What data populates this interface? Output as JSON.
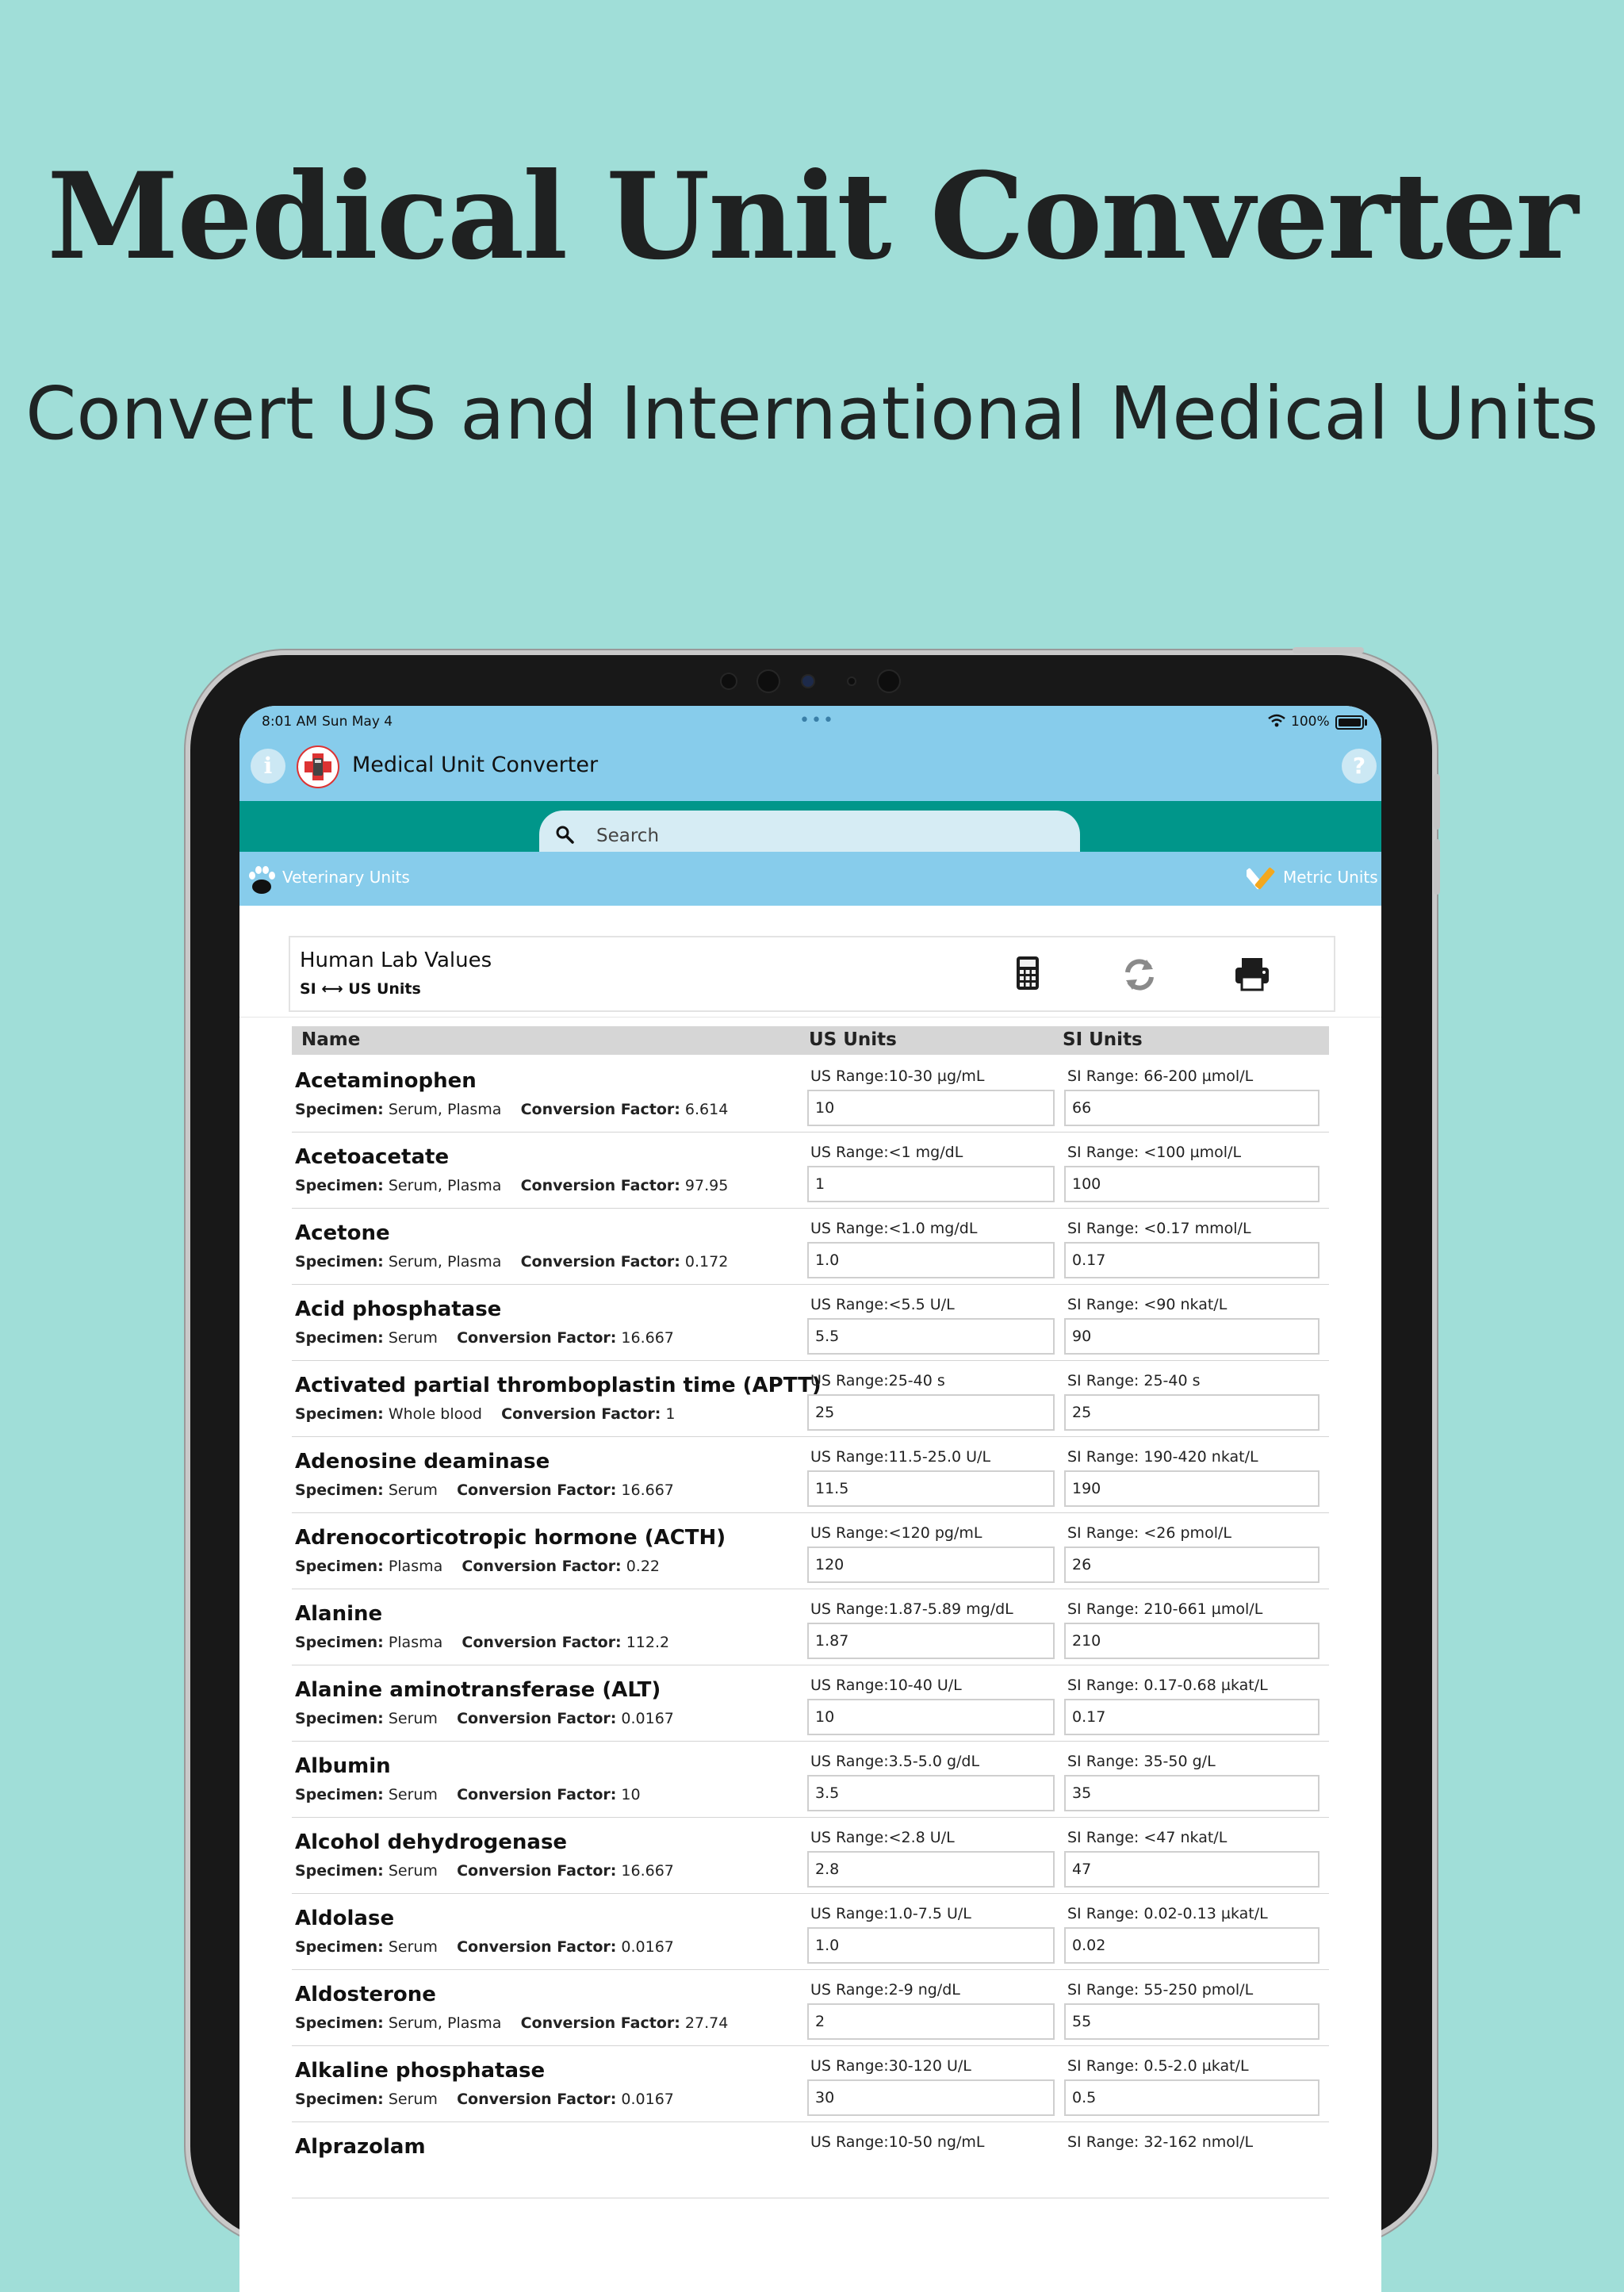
{
  "promo": {
    "title": "Medical Unit Converter",
    "subtitle": "Convert US and International Medical Units"
  },
  "status": {
    "time": "8:01 AM",
    "date": "Sun May 4",
    "battery": "100%"
  },
  "header": {
    "title": "Medical Unit Converter",
    "info_icon": "i",
    "help_icon": "?"
  },
  "search": {
    "placeholder": "Search"
  },
  "units_bar": {
    "left": "Veterinary Units",
    "right": "Metric Units"
  },
  "card": {
    "title": "Human Lab Values",
    "subtitle": "SI ⟷ US Units"
  },
  "table": {
    "headers": {
      "name": "Name",
      "us": "US Units",
      "si": "SI Units"
    },
    "specimen_label": "Specimen:",
    "factor_label": "Conversion Factor:",
    "rows": [
      {
        "name": "Acetaminophen",
        "specimen": "Serum, Plasma",
        "factor": "6.614",
        "us_range": "US Range:10-30 µg/mL",
        "si_range": "SI Range: 66-200 µmol/L",
        "us_value": "10",
        "si_value": "66"
      },
      {
        "name": "Acetoacetate",
        "specimen": "Serum, Plasma",
        "factor": "97.95",
        "us_range": "US Range:<1 mg/dL",
        "si_range": "SI Range: <100 µmol/L",
        "us_value": "1",
        "si_value": "100"
      },
      {
        "name": "Acetone",
        "specimen": "Serum, Plasma",
        "factor": "0.172",
        "us_range": "US Range:<1.0 mg/dL",
        "si_range": "SI Range: <0.17 mmol/L",
        "us_value": "1.0",
        "si_value": "0.17"
      },
      {
        "name": "Acid phosphatase",
        "specimen": "Serum",
        "factor": "16.667",
        "us_range": "US Range:<5.5 U/L",
        "si_range": "SI Range: <90 nkat/L",
        "us_value": "5.5",
        "si_value": "90"
      },
      {
        "name": "Activated partial thromboplastin time (APTT)",
        "specimen": "Whole blood",
        "factor": "1",
        "us_range": "US Range:25-40 s",
        "si_range": "SI Range: 25-40 s",
        "us_value": "25",
        "si_value": "25"
      },
      {
        "name": "Adenosine deaminase",
        "specimen": "Serum",
        "factor": "16.667",
        "us_range": "US Range:11.5-25.0 U/L",
        "si_range": "SI Range: 190-420 nkat/L",
        "us_value": "11.5",
        "si_value": "190"
      },
      {
        "name": "Adrenocorticotropic hormone (ACTH)",
        "specimen": "Plasma",
        "factor": "0.22",
        "us_range": "US Range:<120 pg/mL",
        "si_range": "SI Range: <26 pmol/L",
        "us_value": "120",
        "si_value": "26"
      },
      {
        "name": "Alanine",
        "specimen": "Plasma",
        "factor": "112.2",
        "us_range": "US Range:1.87-5.89 mg/dL",
        "si_range": "SI Range: 210-661 µmol/L",
        "us_value": "1.87",
        "si_value": "210"
      },
      {
        "name": "Alanine aminotransferase (ALT)",
        "specimen": "Serum",
        "factor": "0.0167",
        "us_range": "US Range:10-40 U/L",
        "si_range": "SI Range: 0.17-0.68 µkat/L",
        "us_value": "10",
        "si_value": "0.17"
      },
      {
        "name": "Albumin",
        "specimen": "Serum",
        "factor": "10",
        "us_range": "US Range:3.5-5.0 g/dL",
        "si_range": "SI Range: 35-50 g/L",
        "us_value": "3.5",
        "si_value": "35"
      },
      {
        "name": "Alcohol dehydrogenase",
        "specimen": "Serum",
        "factor": "16.667",
        "us_range": "US Range:<2.8 U/L",
        "si_range": "SI Range: <47 nkat/L",
        "us_value": "2.8",
        "si_value": "47"
      },
      {
        "name": "Aldolase",
        "specimen": "Serum",
        "factor": "0.0167",
        "us_range": "US Range:1.0-7.5 U/L",
        "si_range": "SI Range: 0.02-0.13 µkat/L",
        "us_value": "1.0",
        "si_value": "0.02"
      },
      {
        "name": "Aldosterone",
        "specimen": "Serum, Plasma",
        "factor": "27.74",
        "us_range": "US Range:2-9 ng/dL",
        "si_range": "SI Range: 55-250 pmol/L",
        "us_value": "2",
        "si_value": "55"
      },
      {
        "name": "Alkaline phosphatase",
        "specimen": "Serum",
        "factor": "0.0167",
        "us_range": "US Range:30-120 U/L",
        "si_range": "SI Range: 0.5-2.0 µkat/L",
        "us_value": "30",
        "si_value": "0.5"
      },
      {
        "name": "Alprazolam",
        "specimen": "",
        "factor": "",
        "us_range": "US Range:10-50 ng/mL",
        "si_range": "SI Range: 32-162 nmol/L",
        "us_value": "",
        "si_value": ""
      }
    ]
  },
  "colors": {
    "page_bg": "#a0ded8",
    "header_bg": "#87cceb",
    "search_bar_bg": "#00968a",
    "table_header_bg": "#d6d6d6"
  },
  "icons": [
    "info-icon",
    "app-logo-icon",
    "help-icon",
    "search-icon",
    "paw-icon",
    "pencil-ruler-icon",
    "calculator-icon",
    "refresh-icon",
    "printer-icon",
    "wifi-icon",
    "battery-icon"
  ]
}
